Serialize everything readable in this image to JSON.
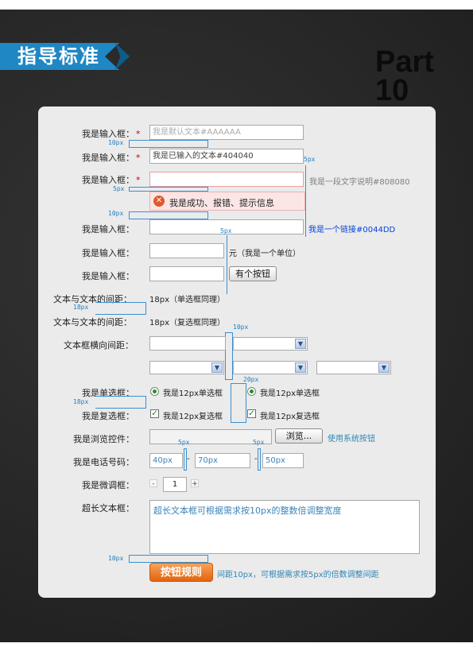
{
  "header": {
    "badge": "指导标准",
    "part": "Part 10"
  },
  "rows": {
    "r1": {
      "label": "我是输入框：",
      "star": "*",
      "placeholder": "我是默认文本#AAAAAA"
    },
    "r2": {
      "label": "我是输入框：",
      "star": "*",
      "value": "我是已输入的文本#404040"
    },
    "r3": {
      "label": "我是输入框：",
      "star": "*",
      "desc": "我是一段文字说明#808080"
    },
    "message": "我是成功、报错、提示信息",
    "r4": {
      "label": "我是输入框：",
      "link": "我是一个链接#0044DD"
    },
    "r5": {
      "label": "我是输入框：",
      "unit": "元（我是一个单位）"
    },
    "r6": {
      "label": "我是输入框：",
      "button": "有个按钮"
    },
    "r7": {
      "label": "文本与文本的间距：",
      "note": "18px（单选框同理）"
    },
    "r8": {
      "label": "文本与文本的间距：",
      "note": "18px（复选框同理）"
    },
    "r9": {
      "label": "文本框横向间距："
    },
    "radio": {
      "label": "我是单选框：",
      "opt1": "我是12px单选框",
      "opt2": "我是12px单选框"
    },
    "checkbox": {
      "label": "我是复选框：",
      "opt1": "我是12px复选框",
      "opt2": "我是12px复选框"
    },
    "browse": {
      "label": "我是浏览控件：",
      "button": "浏览...",
      "note": "使用系统按钮"
    },
    "phone": {
      "label": "我是电话号码：",
      "p1": "40px",
      "p2": "70px",
      "p3": "50px"
    },
    "stepper": {
      "label": "我是微调框：",
      "minus": "-",
      "value": "1",
      "plus": "+"
    },
    "textarea": {
      "label": "超长文本框：",
      "text": "超长文本框可根据需求按10px的整数倍调整宽度"
    },
    "submit": {
      "button": "按钮规则",
      "note": "间距10px，可根据需求按5px的倍数调整间距"
    }
  },
  "annotations": {
    "a1": "10px",
    "a2": "5px",
    "a3": "5px",
    "a4": "10px",
    "a5": "5px",
    "a6": "18px",
    "a7": "10px",
    "a8": "20px",
    "a9": "18px",
    "a10": "5px",
    "a11": "5px",
    "a12": "10px"
  },
  "colors": {
    "accent": "#1e87c4",
    "link": "#0044dd",
    "required": "#cc0000",
    "orange": "#e2640e"
  }
}
